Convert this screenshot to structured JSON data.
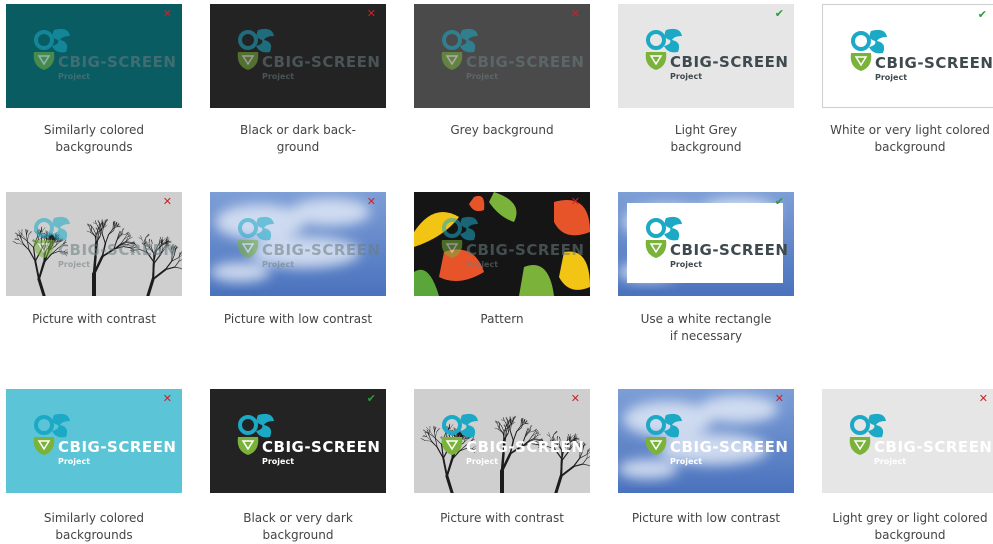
{
  "logo": {
    "title_prefix": "CBIG",
    "title_suffix": "SCREEN",
    "subtitle": "Project"
  },
  "colors": {
    "teal_dark": "#0a5c63",
    "dark": "#232323",
    "grey": "#4a4a4a",
    "light_grey": "#e6e6e6",
    "white": "#ffffff",
    "cyan": "#5bc4d6",
    "sky": "#5a82c4",
    "logo_cyan": "#1ba9c6",
    "logo_green": "#7ab23a",
    "logo_dark_text": "#3f4a4f",
    "cross": "#d0202a",
    "check": "#2e9a3a"
  },
  "rows": [
    [
      {
        "id": "similarly-colored",
        "bg": "teal",
        "mark": "cross",
        "caption": [
          "Similarly colored",
          "backgrounds"
        ]
      },
      {
        "id": "dark",
        "bg": "dark",
        "mark": "cross",
        "caption": [
          "Black or dark back-",
          "ground"
        ]
      },
      {
        "id": "grey",
        "bg": "grey",
        "mark": "cross",
        "caption": [
          "Grey background"
        ]
      },
      {
        "id": "light-grey",
        "bg": "lightgrey",
        "mark": "check",
        "caption": [
          "Light Grey",
          "background"
        ]
      },
      {
        "id": "white",
        "bg": "white",
        "mark": "check",
        "caption": [
          "White or very light colored",
          "background"
        ]
      }
    ],
    [
      {
        "id": "picture-contrast",
        "bg": "tree",
        "mark": "cross",
        "caption": [
          "Picture with contrast"
        ]
      },
      {
        "id": "picture-low-contrast",
        "bg": "sky",
        "mark": "cross",
        "caption": [
          "Picture with low contrast"
        ]
      },
      {
        "id": "pattern",
        "bg": "pattern",
        "mark": "cross",
        "caption": [
          "Pattern"
        ]
      },
      {
        "id": "white-rectangle",
        "bg": "sky-rect",
        "mark": "check",
        "caption": [
          "Use a white rectangle",
          "if necessary"
        ]
      }
    ],
    [
      {
        "id": "similarly-colored-2",
        "bg": "cyan",
        "mark": "cross",
        "caption": [
          "Similarly colored",
          "backgrounds"
        ]
      },
      {
        "id": "dark-2",
        "bg": "dark",
        "mark": "check",
        "caption": [
          "Black or very dark",
          "background"
        ]
      },
      {
        "id": "picture-contrast-2",
        "bg": "tree",
        "mark": "cross",
        "caption": [
          "Picture with contrast"
        ]
      },
      {
        "id": "picture-low-contrast-2",
        "bg": "sky",
        "mark": "cross",
        "caption": [
          "Picture with low contrast"
        ]
      },
      {
        "id": "light-grey-2",
        "bg": "lightgrey",
        "mark": "cross",
        "caption": [
          "Light grey or light colored",
          "background"
        ]
      }
    ]
  ],
  "marks": {
    "cross": "✕",
    "check": "✔"
  }
}
